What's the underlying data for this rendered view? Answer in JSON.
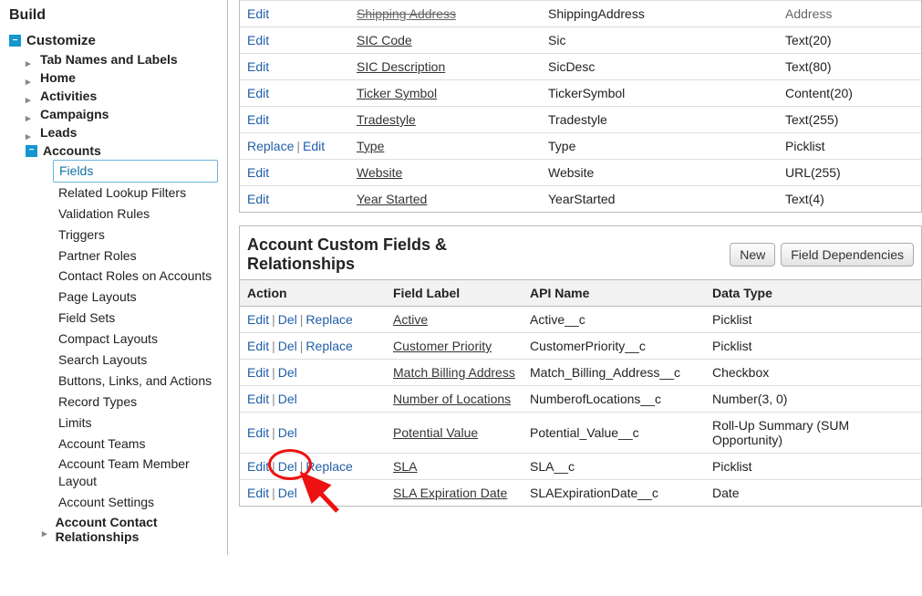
{
  "sidebar": {
    "build": "Build",
    "customize": "Customize",
    "items": [
      "Tab Names and Labels",
      "Home",
      "Activities",
      "Campaigns",
      "Leads"
    ],
    "accounts": "Accounts",
    "accounts_children": [
      "Fields",
      "Related Lookup Filters",
      "Validation Rules",
      "Triggers",
      "Partner Roles",
      "Contact Roles on Accounts",
      "Page Layouts",
      "Field Sets",
      "Compact Layouts",
      "Search Layouts",
      "Buttons, Links, and Actions",
      "Record Types",
      "Limits",
      "Account Teams",
      "Account Team Member Layout",
      "Account Settings"
    ],
    "account_contact_rel": "Account Contact Relationships"
  },
  "actions": {
    "edit": "Edit",
    "del": "Del",
    "replace": "Replace"
  },
  "standard_fields": [
    {
      "actions": [
        "Edit"
      ],
      "label": "Shipping Address",
      "api": "ShippingAddress",
      "type": "Address",
      "strike": true
    },
    {
      "actions": [
        "Edit"
      ],
      "label": "SIC Code",
      "api": "Sic",
      "type": "Text(20)"
    },
    {
      "actions": [
        "Edit"
      ],
      "label": "SIC Description",
      "api": "SicDesc",
      "type": "Text(80)"
    },
    {
      "actions": [
        "Edit"
      ],
      "label": "Ticker Symbol",
      "api": "TickerSymbol",
      "type": "Content(20)"
    },
    {
      "actions": [
        "Edit"
      ],
      "label": "Tradestyle",
      "api": "Tradestyle",
      "type": "Text(255)"
    },
    {
      "actions": [
        "Replace",
        "Edit"
      ],
      "label": "Type",
      "api": "Type",
      "type": "Picklist"
    },
    {
      "actions": [
        "Edit"
      ],
      "label": "Website",
      "api": "Website",
      "type": "URL(255)"
    },
    {
      "actions": [
        "Edit"
      ],
      "label": "Year Started",
      "api": "YearStarted",
      "type": "Text(4)"
    }
  ],
  "custom_section": {
    "title": "Account Custom Fields & Relationships",
    "btn_new": "New",
    "btn_deps": "Field Dependencies",
    "headers": {
      "action": "Action",
      "label": "Field Label",
      "api": "API Name",
      "type": "Data Type"
    }
  },
  "custom_fields": [
    {
      "actions": [
        "Edit",
        "Del",
        "Replace"
      ],
      "label": "Active",
      "api": "Active__c",
      "type": "Picklist"
    },
    {
      "actions": [
        "Edit",
        "Del",
        "Replace"
      ],
      "label": "Customer Priority",
      "api": "CustomerPriority__c",
      "type": "Picklist"
    },
    {
      "actions": [
        "Edit",
        "Del"
      ],
      "label": "Match Billing Address",
      "api": "Match_Billing_Address__c",
      "type": "Checkbox"
    },
    {
      "actions": [
        "Edit",
        "Del"
      ],
      "label": "Number of Locations",
      "api": "NumberofLocations__c",
      "type": "Number(3, 0)"
    },
    {
      "actions": [
        "Edit",
        "Del"
      ],
      "label": "Potential Value",
      "api": "Potential_Value__c",
      "type": "Roll-Up Summary (SUM Opportunity)"
    },
    {
      "actions": [
        "Edit",
        "Del",
        "Replace"
      ],
      "label": "SLA",
      "api": "SLA__c",
      "type": "Picklist",
      "highlight": true
    },
    {
      "actions": [
        "Edit",
        "Del"
      ],
      "label": "SLA Expiration Date",
      "api": "SLAExpirationDate__c",
      "type": "Date"
    }
  ]
}
